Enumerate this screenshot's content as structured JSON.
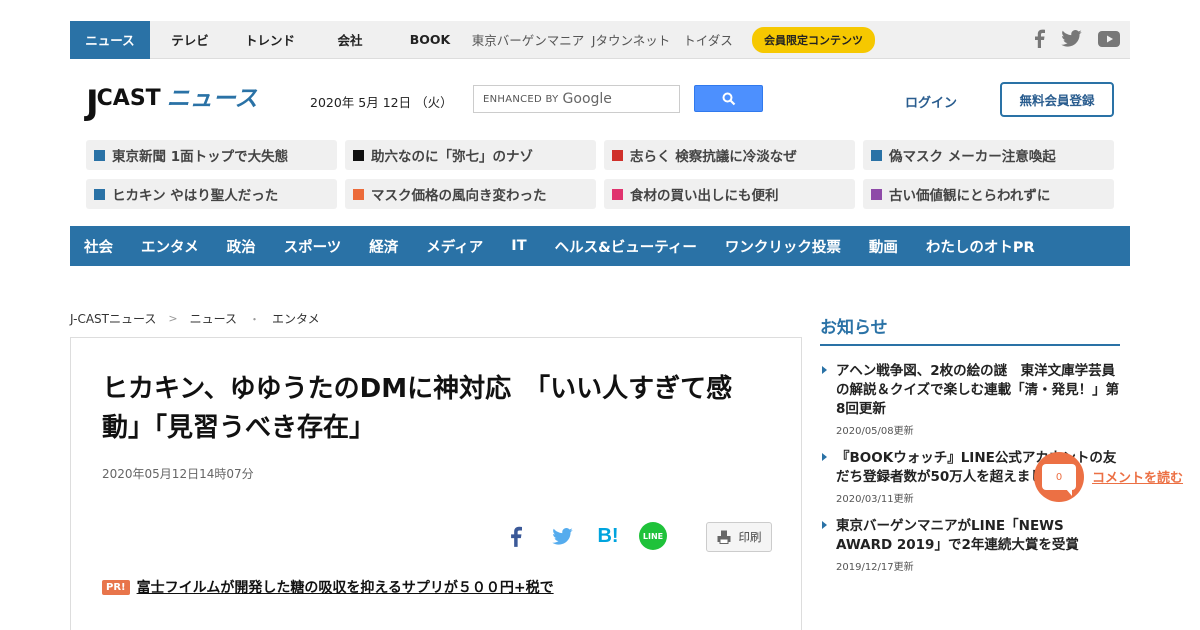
{
  "topnav": {
    "items": [
      "ニュース",
      "テレビ",
      "トレンド",
      "会社",
      "BOOK"
    ],
    "sites": [
      "東京バーゲンマニア",
      "Jタウンネット",
      "トイダス"
    ],
    "member_label": "会員限定コンテンツ",
    "social": [
      "facebook-icon",
      "twitter-icon",
      "youtube-icon"
    ]
  },
  "header": {
    "logo_j": "J",
    "logo_cast": "CAST",
    "logo_news": "ニュース",
    "date": "2020年 5月 12日 （火）",
    "search_brand_prefix": "ENHANCED BY",
    "search_brand": "Google",
    "login": "ログイン",
    "register": "無料会員登録"
  },
  "headlines": [
    {
      "text": "東京新聞 1面トップで大失態",
      "color": "#2a72a6"
    },
    {
      "text": "助六なのに「弥七」のナゾ",
      "color": "#111111"
    },
    {
      "text": "志らく 検察抗議に冷淡なぜ",
      "color": "#d0302a"
    },
    {
      "text": "偽マスク メーカー注意喚起",
      "color": "#2a72a6"
    },
    {
      "text": "ヒカキン やはり聖人だった",
      "color": "#2a72a6"
    },
    {
      "text": "マスク価格の風向き変わった",
      "color": "#ec6b3a"
    },
    {
      "text": "食材の買い出しにも便利",
      "color": "#e0336e"
    },
    {
      "text": "古い価値観にとらわれずに",
      "color": "#8e4aa8"
    }
  ],
  "categories": [
    "社会",
    "エンタメ",
    "政治",
    "スポーツ",
    "経済",
    "メディア",
    "IT",
    "ヘルス&ビューティー",
    "ワンクリック投票",
    "動画",
    "わたしのオトPR"
  ],
  "breadcrumb": [
    "J-CASTニュース",
    "ニュース",
    "エンタメ"
  ],
  "breadcrumb_seps": [
    ">",
    "・"
  ],
  "article": {
    "title": "ヒカキン、ゆゆうたのDMに神対応　「いい人すぎて感動」「見習うべき存在」",
    "date": "2020年05月12日14時07分",
    "share_icons": [
      "facebook-icon",
      "twitter-icon",
      "hatena-icon",
      "line-icon"
    ],
    "hatena_label": "B!",
    "line_label": "LINE",
    "print_label": "印刷",
    "pr_badge": "PR!",
    "pr_text": "富士フイルムが開発した糖の吸収を抑えるサプリが５００円+税で"
  },
  "sidebar": {
    "title": "お知らせ",
    "items": [
      {
        "text": "アヘン戦争図、2枚の絵の謎　東洋文庫学芸員の解説＆クイズで楽しむ連載「清・発見！」第8回更新",
        "date": "2020/05/08更新"
      },
      {
        "text": "『BOOKウォッチ』LINE公式アカウントの友だち登録者数が50万人を超えました！",
        "date": "2020/03/11更新"
      },
      {
        "text": "東京バーゲンマニアがLINE「NEWS AWARD 2019」で2年連続大賞を受賞",
        "date": "2019/12/17更新"
      }
    ]
  },
  "comment": {
    "count": "0",
    "label": "コメントを読む"
  }
}
